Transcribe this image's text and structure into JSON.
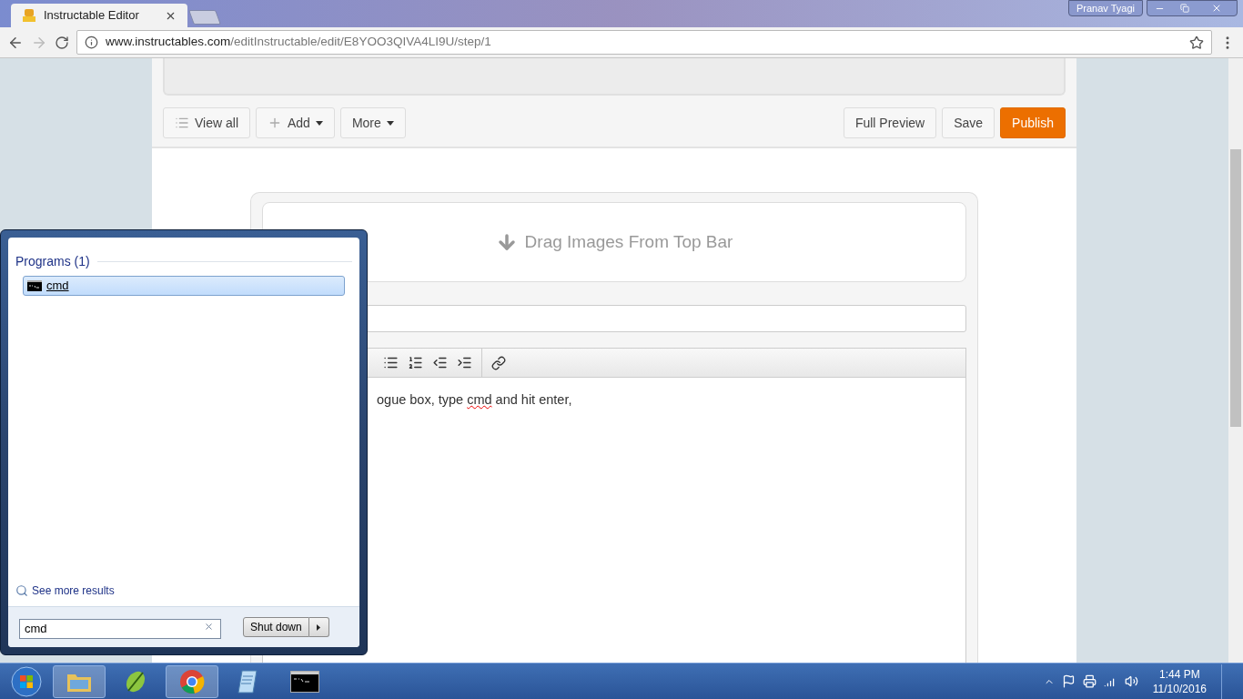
{
  "browser": {
    "tab": {
      "title": "Instructable Editor"
    },
    "profile": "Pranav Tyagi",
    "url": {
      "domain": "www.instructables.com",
      "path": "/editInstructable/edit/E8YOO3QIVA4LI9U/step/1"
    }
  },
  "editor_toolbar": {
    "left_buttons": [
      {
        "label": "View all",
        "kind": "list"
      },
      {
        "label": "Add",
        "kind": "add"
      },
      {
        "label": "More",
        "kind": "menu"
      }
    ],
    "right_buttons": [
      {
        "label": "Full Preview",
        "primary": false
      },
      {
        "label": "Save",
        "primary": false
      },
      {
        "label": "Publish",
        "primary": true
      }
    ]
  },
  "drop_zone": {
    "label": "Drag Images From Top Bar"
  },
  "step_body": {
    "segments": [
      {
        "text": "ogue box, type ",
        "misspelled": false
      },
      {
        "text": "cmd",
        "misspelled": true
      },
      {
        "text": " and hit enter,",
        "misspelled": false
      }
    ]
  },
  "start_menu": {
    "section": "Programs (1)",
    "results": [
      {
        "label": "cmd",
        "selected": true
      }
    ],
    "see_more": "See more results",
    "search": {
      "value": "cmd"
    },
    "shutdown": "Shut down"
  },
  "taskbar": {
    "apps": [
      {
        "kind": "explorer",
        "running": true
      },
      {
        "kind": "leaf",
        "running": false
      },
      {
        "kind": "chrome",
        "running": true
      },
      {
        "kind": "notepad",
        "running": false
      },
      {
        "kind": "console",
        "running": false
      }
    ],
    "clock": {
      "time": "1:44 PM",
      "date": "11/10/2016"
    }
  }
}
